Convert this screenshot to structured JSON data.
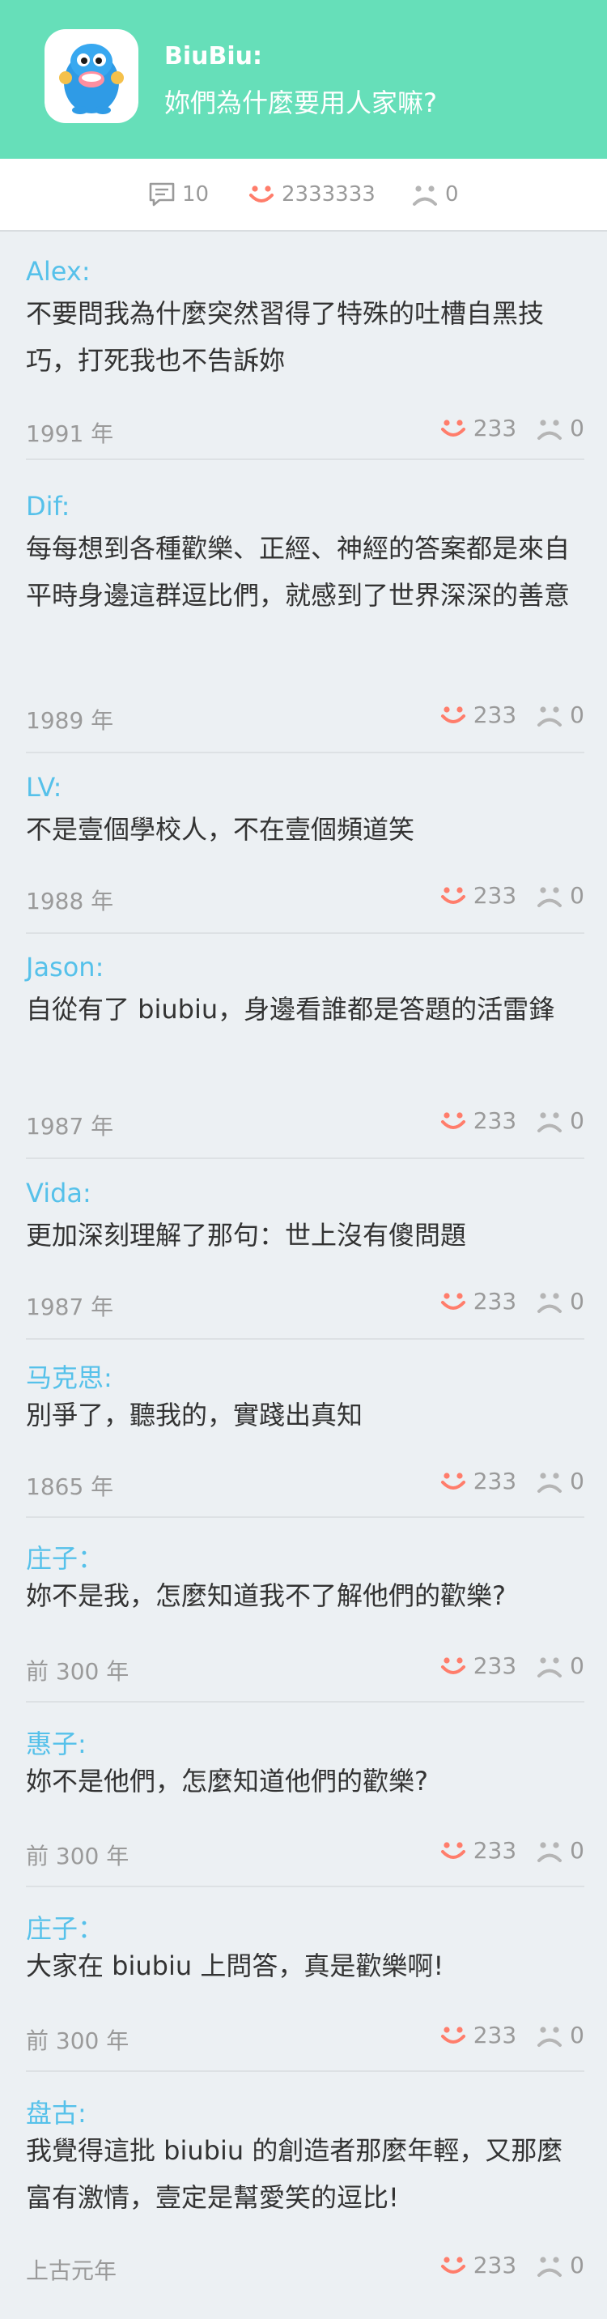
{
  "header": {
    "app_name": "BiuBiu:",
    "question": "妳們為什麼要用人家嘛?"
  },
  "stats": {
    "comments": "10",
    "likes": "2333333",
    "dislikes": "0"
  },
  "colors": {
    "header_bg": "#66dfb9",
    "author": "#56c1ea",
    "smile": "#ff7d6b",
    "frown": "#b5b5b5"
  },
  "comments": [
    {
      "author": "Alex:",
      "text": "不要問我為什麼突然習得了特殊的吐槽自黑技巧，打死我也不告訴妳",
      "date": "1991 年",
      "likes": "233",
      "dislikes": "0"
    },
    {
      "author": "Dif:",
      "text": "每每想到各種歡樂、正經、神經的答案都是來自平時身邊這群逗比們，就感到了世界深深的善意",
      "date": "1989 年",
      "likes": "233",
      "dislikes": "0"
    },
    {
      "author": "LV:",
      "text": "不是壹個學校人，不在壹個頻道笑",
      "date": "1988 年",
      "likes": "233",
      "dislikes": "0"
    },
    {
      "author": "Jason:",
      "text": "自從有了 biubiu，身邊看誰都是答題的活雷鋒",
      "date": "1987 年",
      "likes": "233",
      "dislikes": "0"
    },
    {
      "author": "Vida:",
      "text": "更加深刻理解了那句：世上沒有傻問題",
      "date": "1987 年",
      "likes": "233",
      "dislikes": "0"
    },
    {
      "author": "马克思:",
      "text": "別爭了，聽我的，實踐出真知",
      "date": "1865 年",
      "likes": "233",
      "dislikes": "0"
    },
    {
      "author": "庄子：",
      "text": "妳不是我，怎麼知道我不了解他們的歡樂?",
      "date": "前 300 年",
      "likes": "233",
      "dislikes": "0"
    },
    {
      "author": "惠子:",
      "text": "妳不是他們，怎麼知道他們的歡樂?",
      "date": "前 300 年",
      "likes": "233",
      "dislikes": "0"
    },
    {
      "author": "庄子：",
      "text": "大家在 biubiu 上問答，真是歡樂啊!",
      "date": "前 300 年",
      "likes": "233",
      "dislikes": "0"
    },
    {
      "author": "盘古:",
      "text": "我覺得這批 biubiu 的創造者那麼年輕，又那麼富有激情，壹定是幫愛笑的逗比!",
      "date": "上古元年",
      "likes": "233",
      "dislikes": "0"
    }
  ]
}
